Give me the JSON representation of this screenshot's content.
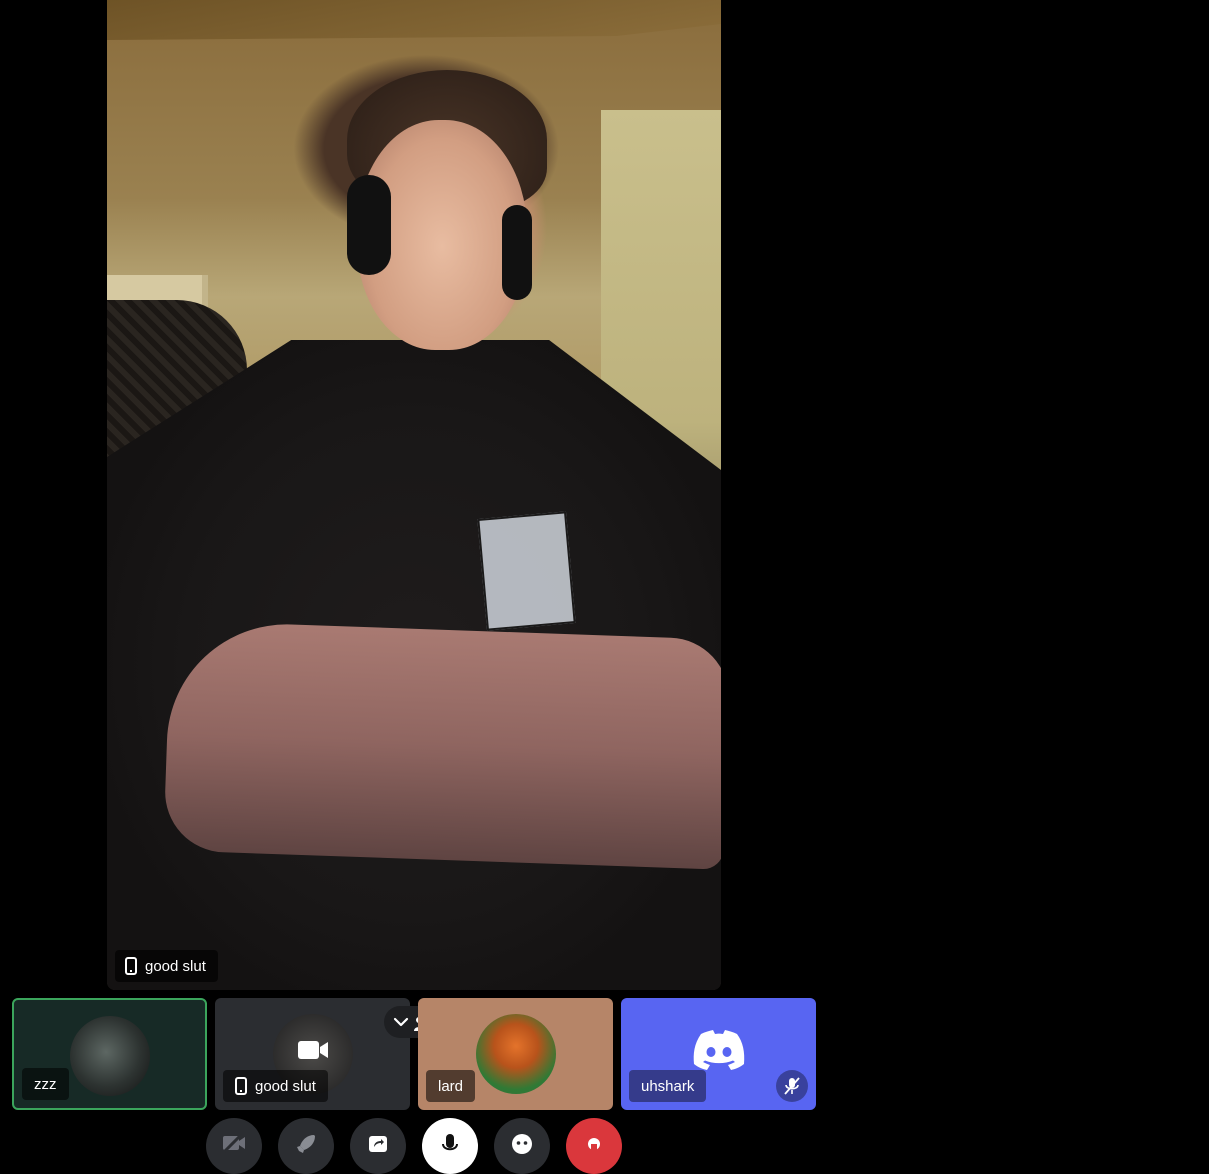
{
  "main_video": {
    "participant_name": "good slut",
    "device_icon": "phone-icon"
  },
  "tiles": [
    {
      "name": "zzz",
      "speaking": true,
      "avatar": "photo-avatar"
    },
    {
      "name": "good slut",
      "device_icon": "phone-icon",
      "overlay_icon": "camera-icon",
      "avatar": "photo-avatar"
    },
    {
      "name": "lard",
      "avatar": "photo-avatar"
    },
    {
      "name": "uhshark",
      "avatar": "discord-logo",
      "status_icon": "muted-icon"
    }
  ],
  "stage_control": {
    "icons": [
      "chevron-down-icon",
      "people-icon"
    ]
  },
  "controls": [
    {
      "name": "camera-off",
      "icon": "camera-off-icon"
    },
    {
      "name": "activities",
      "icon": "rocket-icon"
    },
    {
      "name": "share-screen",
      "icon": "share-screen-icon"
    },
    {
      "name": "microphone",
      "icon": "microphone-icon"
    },
    {
      "name": "soundboard",
      "icon": "soundboard-icon"
    },
    {
      "name": "disconnect",
      "icon": "phone-hangup-icon"
    }
  ],
  "colors": {
    "background": "#000000",
    "speaking_border": "#3ba55c",
    "blurple": "#5865f2",
    "disconnect_red": "#da373c",
    "tile_dark": "#2b2d31"
  }
}
